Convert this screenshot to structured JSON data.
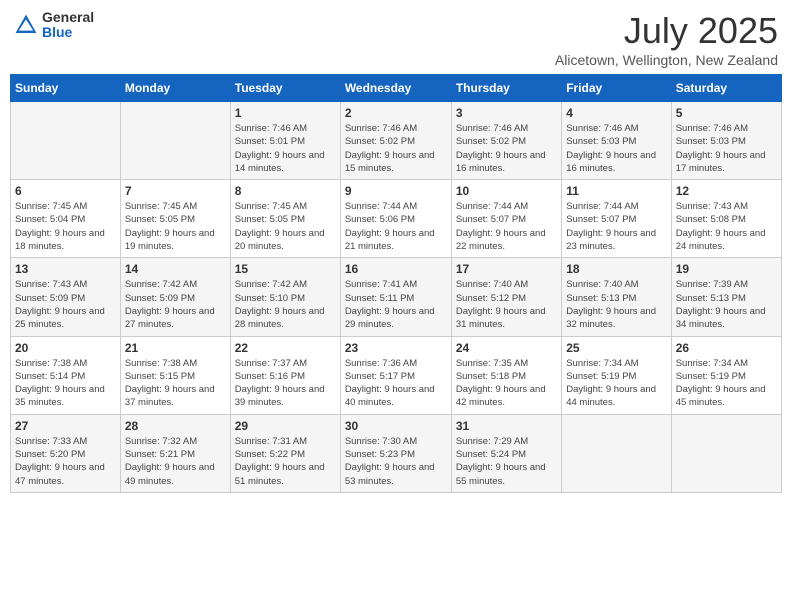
{
  "logo": {
    "general": "General",
    "blue": "Blue"
  },
  "title": "July 2025",
  "subtitle": "Alicetown, Wellington, New Zealand",
  "days_of_week": [
    "Sunday",
    "Monday",
    "Tuesday",
    "Wednesday",
    "Thursday",
    "Friday",
    "Saturday"
  ],
  "weeks": [
    [
      {
        "day": "",
        "info": ""
      },
      {
        "day": "",
        "info": ""
      },
      {
        "day": "1",
        "info": "Sunrise: 7:46 AM\nSunset: 5:01 PM\nDaylight: 9 hours and 14 minutes."
      },
      {
        "day": "2",
        "info": "Sunrise: 7:46 AM\nSunset: 5:02 PM\nDaylight: 9 hours and 15 minutes."
      },
      {
        "day": "3",
        "info": "Sunrise: 7:46 AM\nSunset: 5:02 PM\nDaylight: 9 hours and 16 minutes."
      },
      {
        "day": "4",
        "info": "Sunrise: 7:46 AM\nSunset: 5:03 PM\nDaylight: 9 hours and 16 minutes."
      },
      {
        "day": "5",
        "info": "Sunrise: 7:46 AM\nSunset: 5:03 PM\nDaylight: 9 hours and 17 minutes."
      }
    ],
    [
      {
        "day": "6",
        "info": "Sunrise: 7:45 AM\nSunset: 5:04 PM\nDaylight: 9 hours and 18 minutes."
      },
      {
        "day": "7",
        "info": "Sunrise: 7:45 AM\nSunset: 5:05 PM\nDaylight: 9 hours and 19 minutes."
      },
      {
        "day": "8",
        "info": "Sunrise: 7:45 AM\nSunset: 5:05 PM\nDaylight: 9 hours and 20 minutes."
      },
      {
        "day": "9",
        "info": "Sunrise: 7:44 AM\nSunset: 5:06 PM\nDaylight: 9 hours and 21 minutes."
      },
      {
        "day": "10",
        "info": "Sunrise: 7:44 AM\nSunset: 5:07 PM\nDaylight: 9 hours and 22 minutes."
      },
      {
        "day": "11",
        "info": "Sunrise: 7:44 AM\nSunset: 5:07 PM\nDaylight: 9 hours and 23 minutes."
      },
      {
        "day": "12",
        "info": "Sunrise: 7:43 AM\nSunset: 5:08 PM\nDaylight: 9 hours and 24 minutes."
      }
    ],
    [
      {
        "day": "13",
        "info": "Sunrise: 7:43 AM\nSunset: 5:09 PM\nDaylight: 9 hours and 25 minutes."
      },
      {
        "day": "14",
        "info": "Sunrise: 7:42 AM\nSunset: 5:09 PM\nDaylight: 9 hours and 27 minutes."
      },
      {
        "day": "15",
        "info": "Sunrise: 7:42 AM\nSunset: 5:10 PM\nDaylight: 9 hours and 28 minutes."
      },
      {
        "day": "16",
        "info": "Sunrise: 7:41 AM\nSunset: 5:11 PM\nDaylight: 9 hours and 29 minutes."
      },
      {
        "day": "17",
        "info": "Sunrise: 7:40 AM\nSunset: 5:12 PM\nDaylight: 9 hours and 31 minutes."
      },
      {
        "day": "18",
        "info": "Sunrise: 7:40 AM\nSunset: 5:13 PM\nDaylight: 9 hours and 32 minutes."
      },
      {
        "day": "19",
        "info": "Sunrise: 7:39 AM\nSunset: 5:13 PM\nDaylight: 9 hours and 34 minutes."
      }
    ],
    [
      {
        "day": "20",
        "info": "Sunrise: 7:38 AM\nSunset: 5:14 PM\nDaylight: 9 hours and 35 minutes."
      },
      {
        "day": "21",
        "info": "Sunrise: 7:38 AM\nSunset: 5:15 PM\nDaylight: 9 hours and 37 minutes."
      },
      {
        "day": "22",
        "info": "Sunrise: 7:37 AM\nSunset: 5:16 PM\nDaylight: 9 hours and 39 minutes."
      },
      {
        "day": "23",
        "info": "Sunrise: 7:36 AM\nSunset: 5:17 PM\nDaylight: 9 hours and 40 minutes."
      },
      {
        "day": "24",
        "info": "Sunrise: 7:35 AM\nSunset: 5:18 PM\nDaylight: 9 hours and 42 minutes."
      },
      {
        "day": "25",
        "info": "Sunrise: 7:34 AM\nSunset: 5:19 PM\nDaylight: 9 hours and 44 minutes."
      },
      {
        "day": "26",
        "info": "Sunrise: 7:34 AM\nSunset: 5:19 PM\nDaylight: 9 hours and 45 minutes."
      }
    ],
    [
      {
        "day": "27",
        "info": "Sunrise: 7:33 AM\nSunset: 5:20 PM\nDaylight: 9 hours and 47 minutes."
      },
      {
        "day": "28",
        "info": "Sunrise: 7:32 AM\nSunset: 5:21 PM\nDaylight: 9 hours and 49 minutes."
      },
      {
        "day": "29",
        "info": "Sunrise: 7:31 AM\nSunset: 5:22 PM\nDaylight: 9 hours and 51 minutes."
      },
      {
        "day": "30",
        "info": "Sunrise: 7:30 AM\nSunset: 5:23 PM\nDaylight: 9 hours and 53 minutes."
      },
      {
        "day": "31",
        "info": "Sunrise: 7:29 AM\nSunset: 5:24 PM\nDaylight: 9 hours and 55 minutes."
      },
      {
        "day": "",
        "info": ""
      },
      {
        "day": "",
        "info": ""
      }
    ]
  ]
}
